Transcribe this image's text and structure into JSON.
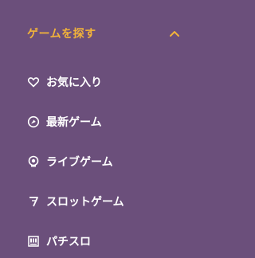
{
  "section": {
    "title": "ゲームを探す",
    "expanded": true,
    "accent_color": "#f2b33a",
    "background_color": "#6b4f7b"
  },
  "items": [
    {
      "label": "お気に入り",
      "icon": "heart-icon"
    },
    {
      "label": "最新ゲーム",
      "icon": "new-badge-icon"
    },
    {
      "label": "ライブゲーム",
      "icon": "live-chip-icon"
    },
    {
      "label": "スロットゲーム",
      "icon": "lucky-seven-icon"
    },
    {
      "label": "パチスロ",
      "icon": "pachislot-icon"
    }
  ]
}
